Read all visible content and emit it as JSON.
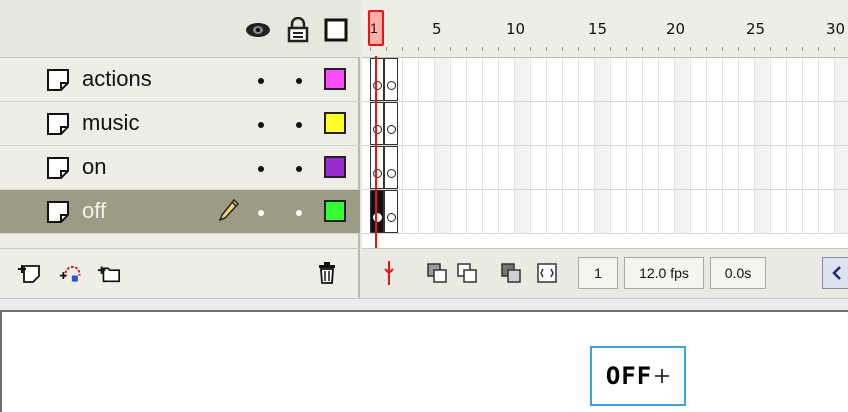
{
  "timeline": {
    "header_icons": [
      "eye-icon",
      "lock-icon",
      "outline-icon"
    ],
    "layers": [
      {
        "name": "actions",
        "color": "#ff4cff",
        "selected": false
      },
      {
        "name": "music",
        "color": "#ffff2a",
        "selected": false
      },
      {
        "name": "on",
        "color": "#9b2bd1",
        "selected": false
      },
      {
        "name": "off",
        "color": "#33ff33",
        "selected": true
      }
    ],
    "ruler_numbers": [
      "1",
      "5",
      "10",
      "15",
      "20",
      "25",
      "30"
    ],
    "current_frame": "1",
    "fps": "12.0 fps",
    "elapsed": "0.0s"
  },
  "stage": {
    "object_text": "OFF"
  }
}
